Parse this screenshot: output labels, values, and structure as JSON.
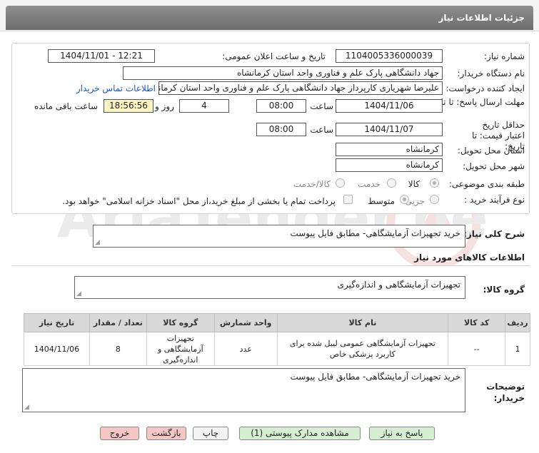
{
  "header": {
    "title": "جزئیات اطلاعات نیاز"
  },
  "fields": {
    "need_number_label": "شماره نیاز:",
    "need_number": "1104005336000039",
    "announce_label": "تاریخ و ساعت اعلان عمومی:",
    "announce_value": "1404/11/01 - 12:21",
    "buyer_org_label": "نام دستگاه خریدار:",
    "buyer_org": "جهاد دانشگاهی پارک علم و فناوری واحد استان کرمانشاه",
    "requester_label": "ایجاد کننده درخواست:",
    "requester": "علیرضا شهریاری کارپرداز جهاد دانشگاهی پارک علم و فناوری واحد استان کرمانشاه",
    "contact_link": "اطلاعات تماس خریدار",
    "reply_deadline_label": "مهلت ارسال پاسخ: تا تاریخ:",
    "reply_date": "1404/11/06",
    "time_label": "ساعت",
    "reply_time": "08:00",
    "days_value": "4",
    "days_and_label": "روز و",
    "remaining_time": "18:56:56",
    "remaining_label": "ساعت باقی مانده",
    "validity_label": "حداقل تاریخ اعتبار قیمت: تا تاریخ:",
    "validity_date": "1404/11/07",
    "validity_time": "08:00",
    "province_label": "استان محل تحویل:",
    "province": "کرمانشاه",
    "city_label": "شهر محل تحویل:",
    "city": "کرمانشاه",
    "category_label": "طبقه بندی موضوعی:",
    "category_options": [
      "کالا",
      "خدمت",
      "کالا/خدمت"
    ],
    "process_label": "نوع فرآیند خرید :",
    "process_options": [
      "جزیی",
      "متوسط"
    ],
    "payment_note": "پرداخت تمام یا بخشی از مبلغ خرید،از محل \"اسناد خزانه اسلامی\" خواهد بود."
  },
  "description": {
    "label": "شرح کلی نیاز:",
    "value": "خرید تجهیزات آزمایشگاهی- مطابق فایل پیوست"
  },
  "goods": {
    "section_title": "اطلاعات کالاهای مورد نیاز",
    "group_label": "گروه کالا:",
    "group_value": "تجهیزات آزمایشگاهی و اندازه‌گیری",
    "columns": [
      "ردیف",
      "کد کالا",
      "نام کالا",
      "واحد شمارش",
      "گروه کالا",
      "تعداد / مقدار",
      "تاریخ نیاز"
    ],
    "rows": [
      {
        "row": "1",
        "code": "--",
        "name": "تجهیزات آزمایشگاهی عمومی لیبل شده برای کاربرد پزشکی خاص",
        "unit": "عدد",
        "group": "تجهیزات آزمایشگاهی و اندازه‌گیری",
        "qty": "8",
        "date": "1404/11/06"
      }
    ]
  },
  "buyer_notes": {
    "label": "توضیحات خریدار:",
    "value": "خرید تجهیزات آزمایشگاهی- مطابق فایل پیوست"
  },
  "buttons": {
    "reply": "پاسخ به نیاز",
    "attachments": "مشاهده مدارک پیوستی (1)",
    "print": "چاپ",
    "back": "بازگشت",
    "exit": "خروج"
  },
  "watermark_text": "AriaTender.neT",
  "colors": {
    "link": "#1a56c8",
    "yellow_field": "#fbf3c3",
    "green_button": "#d6efd2",
    "red_button": "#f5c6c6"
  }
}
